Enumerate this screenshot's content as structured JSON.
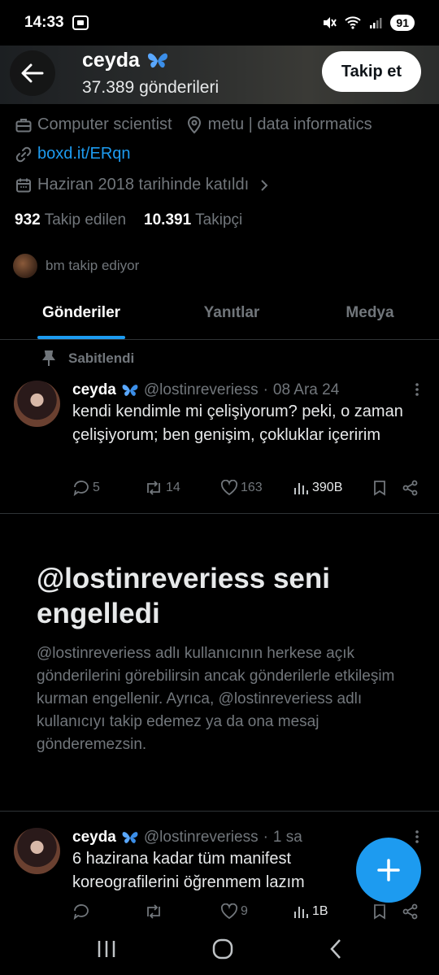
{
  "status_bar": {
    "time": "14:33",
    "battery": "91",
    "icons": [
      "screen-record-icon",
      "mute-icon",
      "wifi-icon",
      "signal-icon"
    ]
  },
  "header": {
    "name": "ceyda",
    "badge_icon": "butterfly-icon",
    "post_count": "37.389 gönderileri",
    "follow_label": "Takip et"
  },
  "profile": {
    "occupation": "Computer scientist",
    "location": "metu | data informatics",
    "link": "boxd.it/ERqn",
    "joined": "Haziran 2018 tarihinde katıldı",
    "following_count": "932",
    "following_label": "Takip edilen",
    "followers_count": "10.391",
    "followers_label": "Takipçi",
    "followed_by": "bm takip ediyor"
  },
  "tabs": [
    {
      "label": "Gönderiler",
      "active": true
    },
    {
      "label": "Yanıtlar",
      "active": false
    },
    {
      "label": "Medya",
      "active": false
    }
  ],
  "pinned_label": "Sabitlendi",
  "posts": [
    {
      "name": "ceyda",
      "handle": "@lostinreveriess",
      "time": "08 Ara 24",
      "text": "kendi kendimle mi çelişiyorum? peki, o zaman çelişiyorum; ben genişim, çokluklar içeririm",
      "replies": "5",
      "reposts": "14",
      "likes": "163",
      "views": "390B"
    },
    {
      "name": "ceyda",
      "handle": "@lostinreveriess",
      "time": "1 sa",
      "text": "6 hazirana kadar tüm manifest koreografilerini öğrenmem lazım",
      "replies": "",
      "reposts": "",
      "likes": "9",
      "views": "1B"
    }
  ],
  "blocked": {
    "title": "@lostinreveriess seni engelledi",
    "description": "@lostinreveriess adlı kullanıcının herkese açık gönderilerini görebilirsin ancak gönderilerle etkileşim kurman engellenir. Ayrıca, @lostinreveriess adlı kullanıcıyı takip edemez ya da ona mesaj gönderemezsin."
  },
  "colors": {
    "accent": "#1d9bf0",
    "background": "#000000",
    "muted": "#71767b"
  }
}
